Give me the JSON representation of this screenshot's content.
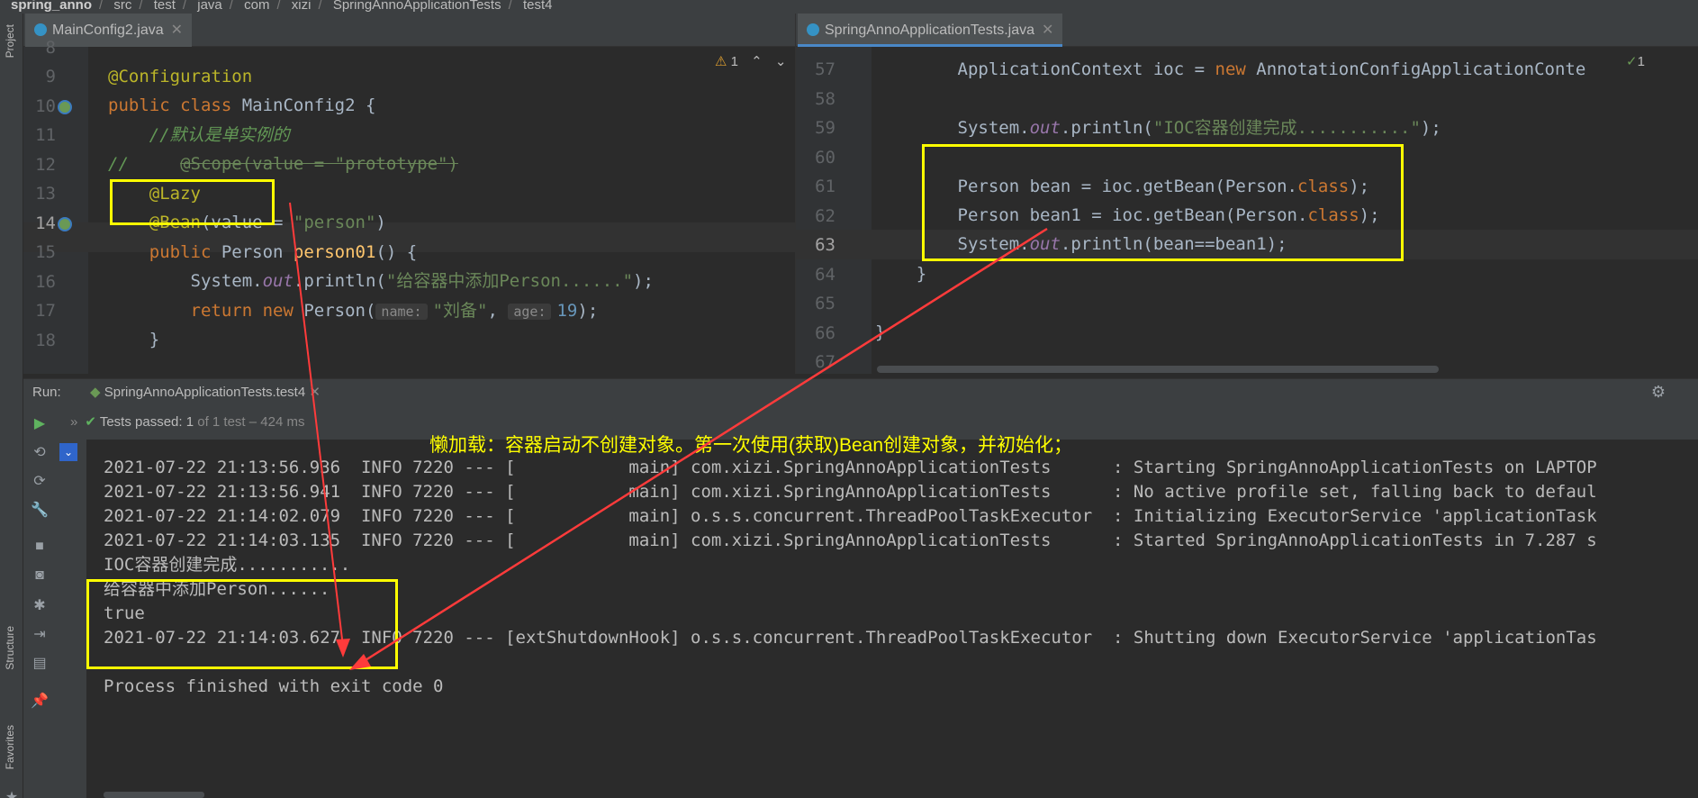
{
  "breadcrumb": [
    "spring_anno",
    "src",
    "test",
    "java",
    "com",
    "xizi",
    "SpringAnnoApplicationTests",
    "test4"
  ],
  "left_strip": {
    "project": "Project",
    "structure": "Structure",
    "favorites": "Favorites"
  },
  "editor1": {
    "tab": "MainConfig2.java",
    "warnings": "1",
    "lines": [
      {
        "n": "8"
      },
      {
        "n": "9"
      },
      {
        "n": "10"
      },
      {
        "n": "11"
      },
      {
        "n": "12"
      },
      {
        "n": "13"
      },
      {
        "n": "14"
      },
      {
        "n": "15"
      },
      {
        "n": "16"
      },
      {
        "n": "17"
      },
      {
        "n": "18"
      }
    ],
    "code": {
      "l9": "@Configuration",
      "l10_kw": "public class ",
      "l10_rest": "MainConfig2 {",
      "l11": "    //默认是单实例的",
      "l12_a": "//     ",
      "l12_b": "@Scope(value = \"prototype\")",
      "l13": "    @Lazy",
      "l14_a": "    @Bean",
      "l14_b": "(value = ",
      "l14_c": "\"person\"",
      "l14_d": ")",
      "l15_kw": "    public ",
      "l15_t": "Person ",
      "l15_fn": "person01",
      "l15_e": "() {",
      "l16_a": "        System.",
      "l16_out": "out",
      "l16_b": ".println(",
      "l16_s": "\"给容器中添加Person......\"",
      "l16_e": ");",
      "l17_kw": "        return new ",
      "l17_t": "Person(",
      "l17_h1": "name:",
      "l17_s": "\"刘备\"",
      "l17_c": ", ",
      "l17_h2": "age:",
      "l17_n": "19",
      "l17_e": ");",
      "l18": "    }"
    }
  },
  "editor2": {
    "tab": "SpringAnnoApplicationTests.java",
    "warnings": "1",
    "lines": [
      {
        "n": "57"
      },
      {
        "n": "58"
      },
      {
        "n": "59"
      },
      {
        "n": "60"
      },
      {
        "n": "61"
      },
      {
        "n": "62"
      },
      {
        "n": "63"
      },
      {
        "n": "64"
      },
      {
        "n": "65"
      },
      {
        "n": "66"
      },
      {
        "n": "67"
      }
    ],
    "code": {
      "l57_a": "        ApplicationContext ioc = ",
      "l57_kw": "new ",
      "l57_b": "AnnotationConfigApplicationConte",
      "l59_a": "        System.",
      "l59_out": "out",
      "l59_b": ".println(",
      "l59_s": "\"IOC容器创建完成...........\"",
      "l59_e": ");",
      "l61_a": "        Person bean = ioc.getBean(Person.",
      "l61_kw": "class",
      "l61_e": ");",
      "l62_a": "        Person bean1 = ioc.getBean(Person.",
      "l62_kw": "class",
      "l62_e": ");",
      "l63_a": "        System.",
      "l63_out": "out",
      "l63_b": ".println(bean==bean1);",
      "l64": "    }",
      "l66": "}"
    }
  },
  "run": {
    "label": "Run:",
    "tab": "SpringAnnoApplicationTests.test4",
    "status_bold": "Tests passed: 1",
    "status_rest": " of 1 test – 424 ms"
  },
  "annotation": "懒加载：容器启动不创建对象。第一次使用(获取)Bean创建对象，并初始化；",
  "console": [
    "2021-07-22 21:13:56.936  INFO 7220 --- [           main] com.xizi.SpringAnnoApplicationTests      : Starting SpringAnnoApplicationTests on LAPTOP",
    "2021-07-22 21:13:56.941  INFO 7220 --- [           main] com.xizi.SpringAnnoApplicationTests      : No active profile set, falling back to defaul",
    "2021-07-22 21:14:02.079  INFO 7220 --- [           main] o.s.s.concurrent.ThreadPoolTaskExecutor  : Initializing ExecutorService 'applicationTask",
    "2021-07-22 21:14:03.135  INFO 7220 --- [           main] com.xizi.SpringAnnoApplicationTests      : Started SpringAnnoApplicationTests in 7.287 s",
    "IOC容器创建完成...........",
    "给容器中添加Person......",
    "true",
    "2021-07-22 21:14:03.627  INFO 7220 --- [extShutdownHook] o.s.s.concurrent.ThreadPoolTaskExecutor  : Shutting down ExecutorService 'applicationTas",
    "",
    "Process finished with exit code 0"
  ],
  "colors": {
    "highlight_box": "#ffff00",
    "arrow": "#ff3b3b",
    "accent": "#4a88c7"
  }
}
